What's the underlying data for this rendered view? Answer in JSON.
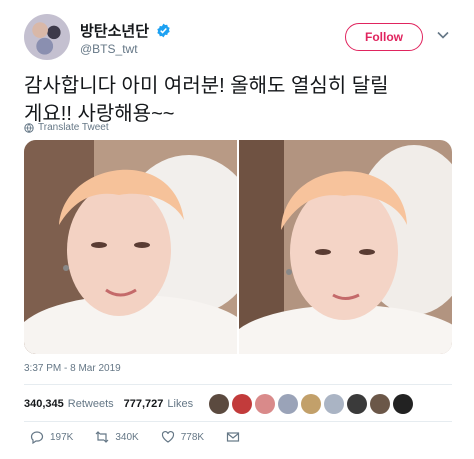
{
  "user": {
    "display_name": "방탄소년단",
    "handle": "@BTS_twt",
    "verified_icon": "verified-badge-icon"
  },
  "follow_label": "Follow",
  "menu_icon": "chevron-down-icon",
  "tweet": {
    "text_line1": "감사합니다 아미 여러분! 올해도 열심히 달릴",
    "text_line2": "게요!! 사랑해용~~",
    "translate_label": "Translate Tweet",
    "timestamp": "3:37 PM - 8 Mar 2019"
  },
  "stats": {
    "retweets_count": "340,345",
    "retweets_label": "Retweets",
    "likes_count": "777,727",
    "likes_label": "Likes"
  },
  "actions": {
    "reply_count": "197K",
    "retweet_count": "340K",
    "like_count": "778K"
  },
  "colors": {
    "accent": "#e0245e",
    "verified": "#1da1f2",
    "muted": "#657786"
  }
}
